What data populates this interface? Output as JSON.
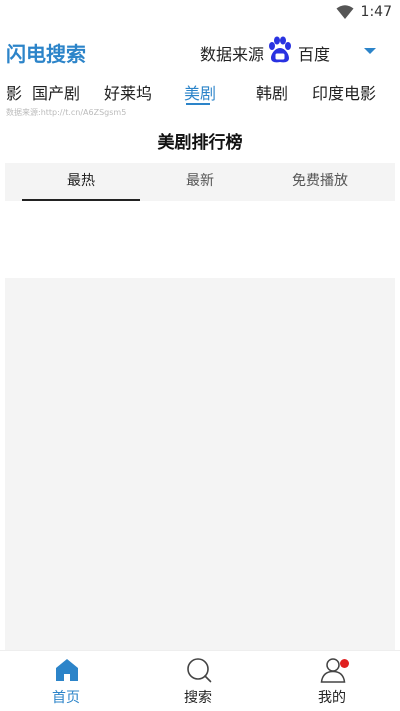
{
  "status_bar": {
    "time": "1:47"
  },
  "header": {
    "app_title": "闪电搜索",
    "source_label": "数据来源",
    "source_name": "百度"
  },
  "category_tabs": [
    {
      "label": "影"
    },
    {
      "label": "国产剧"
    },
    {
      "label": "好莱坞"
    },
    {
      "label": "美剧",
      "active": true
    },
    {
      "label": "韩剧"
    },
    {
      "label": "印度电影"
    }
  ],
  "source_note": "数据来源:http://t.cn/A6ZSgsm5",
  "page_title": "美剧排行榜",
  "sort_tabs": [
    {
      "label": "最热",
      "active": true
    },
    {
      "label": "最新"
    },
    {
      "label": "免费播放"
    }
  ],
  "bottom_nav": [
    {
      "label": "首页",
      "icon": "home-icon",
      "active": true
    },
    {
      "label": "搜索",
      "icon": "search-icon"
    },
    {
      "label": "我的",
      "icon": "user-icon"
    }
  ],
  "colors": {
    "accent": "#2c84c9",
    "badge": "#e02020"
  }
}
